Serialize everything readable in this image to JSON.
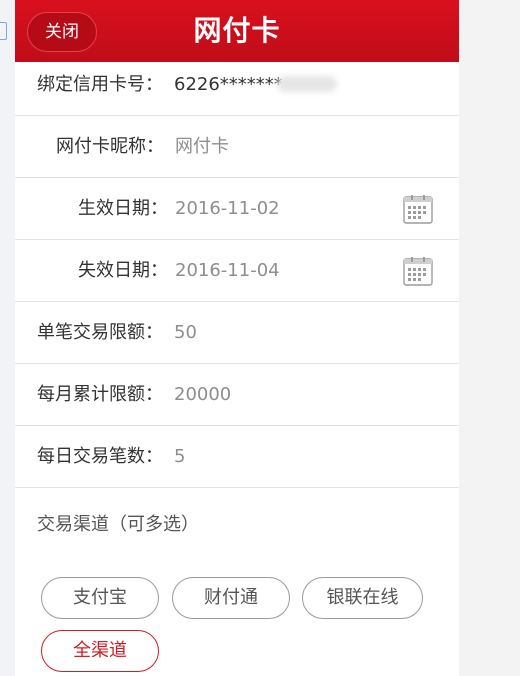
{
  "header": {
    "close_label": "关闭",
    "title": "网付卡"
  },
  "fields": {
    "card_number_label": "绑定信用卡号：",
    "card_number_value": "6226*******",
    "nickname_label": "网付卡昵称：",
    "nickname_value": "网付卡",
    "start_date_label": "生效日期：",
    "start_date_value": "2016-11-02",
    "end_date_label": "失效日期：",
    "end_date_value": "2016-11-04",
    "single_limit_label": "单笔交易限额：",
    "single_limit_value": "50",
    "monthly_limit_label": "每月累计限额：",
    "monthly_limit_value": "20000",
    "daily_count_label": "每日交易笔数：",
    "daily_count_value": "5"
  },
  "channels": {
    "title": "交易渠道（可多选）",
    "options": [
      "支付宝",
      "财付通",
      "银联在线",
      "全渠道"
    ],
    "selected": "全渠道"
  },
  "colors": {
    "header_red": "#d9101d",
    "selected_red": "#d01c24",
    "value_gray": "#8e8e8e"
  },
  "icons": {
    "calendar": "calendar-icon"
  }
}
